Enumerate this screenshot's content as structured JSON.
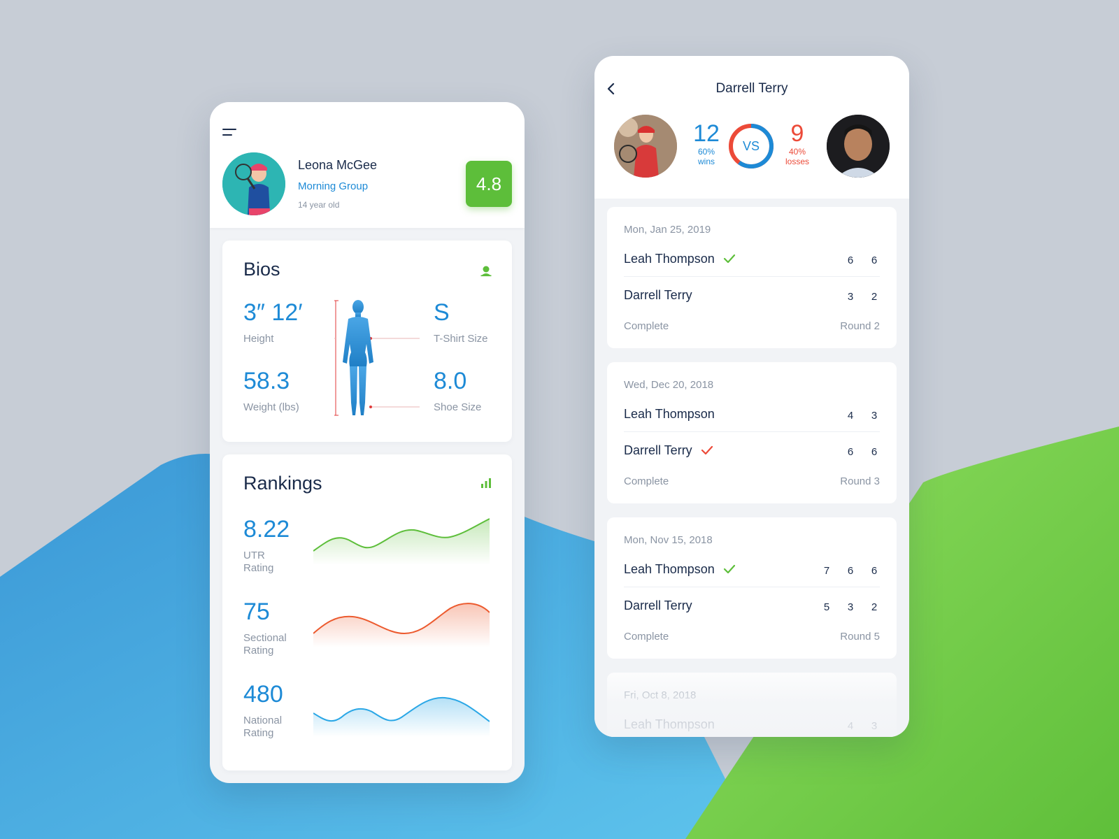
{
  "colors": {
    "accent_blue": "#1d8ad6",
    "accent_green": "#5dbe3a",
    "accent_red": "#ec4a38",
    "text_dark": "#1a2b4a",
    "text_muted": "#8a94a3"
  },
  "profile": {
    "name": "Leona McGee",
    "group": "Morning Group",
    "age": "14 year old",
    "rating": "4.8"
  },
  "bios": {
    "title": "Bios",
    "icon": "user-icon",
    "height_value": "3″ 12′",
    "height_label": "Height",
    "weight_value": "58.3",
    "weight_label": "Weight (lbs)",
    "shirt_value": "S",
    "shirt_label": "T-Shirt Size",
    "shoe_value": "8.0",
    "shoe_label": "Shoe Size"
  },
  "rankings": {
    "title": "Rankings",
    "icon": "bar-chart-icon",
    "items": [
      {
        "value": "8.22",
        "label_line1": "UTR",
        "label_line2": "Rating",
        "color": "#5dbe3a"
      },
      {
        "value": "75",
        "label_line1": "Sectional",
        "label_line2": "Rating",
        "color": "#ec5a2e"
      },
      {
        "value": "480",
        "label_line1": "National",
        "label_line2": "Rating",
        "color": "#2aa7e6"
      }
    ]
  },
  "head_to_head": {
    "title": "Darrell Terry",
    "wins": "12",
    "wins_pct": "60%",
    "wins_label": "wins",
    "losses": "9",
    "losses_pct": "40%",
    "losses_label": "losses",
    "vs_label": "VS",
    "win_fraction": 0.6
  },
  "matches": [
    {
      "date": "Mon, Jan 25, 2019",
      "player1": "Leah Thompson",
      "p1_winner": true,
      "p1_scores": [
        "6",
        "6"
      ],
      "player2": "Darrell Terry",
      "p2_winner": false,
      "p2_scores": [
        "3",
        "2"
      ],
      "status": "Complete",
      "round": "Round 2"
    },
    {
      "date": "Wed, Dec 20, 2018",
      "player1": "Leah Thompson",
      "p1_winner": false,
      "p1_scores": [
        "4",
        "3"
      ],
      "player2": "Darrell Terry",
      "p2_winner": true,
      "p2_scores": [
        "6",
        "6"
      ],
      "status": "Complete",
      "round": "Round 3"
    },
    {
      "date": "Mon, Nov 15, 2018",
      "player1": "Leah Thompson",
      "p1_winner": true,
      "p1_scores": [
        "7",
        "6",
        "6"
      ],
      "player2": "Darrell Terry",
      "p2_winner": false,
      "p2_scores": [
        "5",
        "3",
        "2"
      ],
      "status": "Complete",
      "round": "Round 5"
    },
    {
      "date": "Fri, Oct 8, 2018",
      "player1": "Leah Thompson",
      "p1_winner": false,
      "p1_scores": [
        "4",
        "3"
      ]
    }
  ]
}
